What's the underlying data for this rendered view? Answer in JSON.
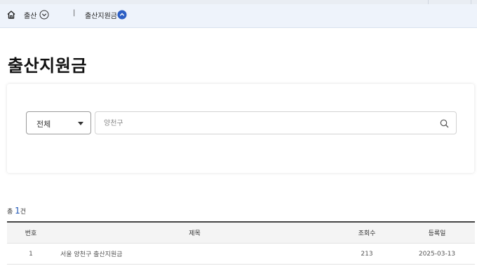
{
  "breadcrumb": {
    "level1": "출산",
    "level2": "출산지원금"
  },
  "page": {
    "title": "출산지원금"
  },
  "search": {
    "category_selected": "전체",
    "placeholder": "양천구"
  },
  "summary": {
    "prefix": "총",
    "count": "1",
    "suffix": "건"
  },
  "table": {
    "headers": {
      "num": "번호",
      "title": "제목",
      "views": "조회수",
      "date": "등록일"
    },
    "rows": [
      {
        "num": "1",
        "title": "서울 양천구 출산지원금",
        "views": "213",
        "date": "2025-03-13"
      }
    ]
  },
  "colors": {
    "accent": "#1d55b5",
    "topbar_bg": "#eef3fb",
    "toggle_active": "#2d5fc4"
  },
  "icons": {
    "home": "home-icon",
    "expand": "chevron-down-circle-icon",
    "collapse": "chevron-up-circle-icon",
    "search": "search-icon",
    "select_caret": "caret-down-icon"
  }
}
